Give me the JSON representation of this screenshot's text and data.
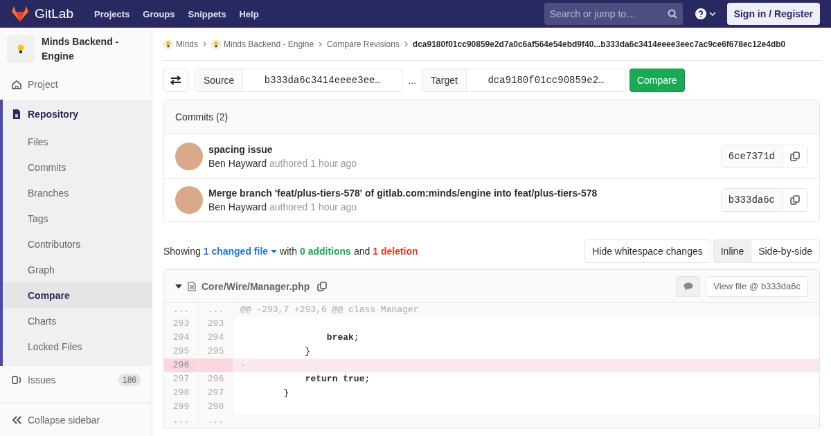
{
  "navbar": {
    "brand": "GitLab",
    "links": [
      "Projects",
      "Groups",
      "Snippets",
      "Help"
    ],
    "search": {
      "placeholder": "Search or jump to…"
    },
    "sign_in": "Sign in / Register"
  },
  "sidebar": {
    "project_name": "Minds Backend - Engine",
    "items": [
      {
        "label": "Project",
        "kind": "project",
        "selected": false
      },
      {
        "label": "Repository",
        "kind": "repository",
        "selected": true,
        "children": [
          {
            "label": "Files",
            "selected": false
          },
          {
            "label": "Commits",
            "selected": false
          },
          {
            "label": "Branches",
            "selected": false
          },
          {
            "label": "Tags",
            "selected": false
          },
          {
            "label": "Contributors",
            "selected": false
          },
          {
            "label": "Graph",
            "selected": false
          },
          {
            "label": "Compare",
            "selected": true
          },
          {
            "label": "Charts",
            "selected": false
          },
          {
            "label": "Locked Files",
            "selected": false
          }
        ]
      },
      {
        "label": "Issues",
        "kind": "issues",
        "selected": false,
        "count": "186"
      }
    ],
    "collapse": "Collapse sidebar"
  },
  "breadcrumbs": [
    {
      "label": "Minds",
      "kind": "group"
    },
    {
      "label": "Minds Backend - Engine",
      "kind": "group"
    },
    {
      "label": "Compare Revisions",
      "kind": "link"
    },
    {
      "label": "dca9180f01cc90859e2d7a0c6af564e54ebd9f40...b333da6c3414eeee3eec7ac9ce6f678ec12e4db0",
      "kind": "current"
    }
  ],
  "compare": {
    "source_label": "Source",
    "source_value": "b333da6c3414eeee3ee…",
    "separator": "...",
    "target_label": "Target",
    "target_value": "dca9180f01cc90859e2…",
    "button": "Compare"
  },
  "commits": {
    "title": "Commits (2)",
    "items": [
      {
        "message": "spacing issue",
        "author": "Ben Hayward",
        "meta": "authored 1 hour ago",
        "sha": "6ce7371d"
      },
      {
        "message": "Merge branch 'feat/plus-tiers-578' of gitlab.com:minds/engine into feat/plus-tiers-578",
        "author": "Ben Hayward",
        "meta": "authored 1 hour ago",
        "sha": "b333da6c"
      }
    ]
  },
  "summary": [
    {
      "text": "Showing",
      "kind": "text"
    },
    {
      "text": "1 changed file",
      "kind": "dropdown"
    },
    {
      "text": "with",
      "kind": "text"
    },
    {
      "text": "0 additions",
      "kind": "added"
    },
    {
      "text": "and",
      "kind": "text"
    },
    {
      "text": "1 deletion",
      "kind": "removed"
    }
  ],
  "whitespace_button": "Hide whitespace changes",
  "view_modes": [
    {
      "label": "Inline",
      "selected": true
    },
    {
      "label": "Side-by-side",
      "selected": false
    }
  ],
  "file": {
    "path": "Core/Wire/Manager.php",
    "view_file": "View file @ b333da6c",
    "lines": [
      {
        "kind": "match",
        "old": "...",
        "new": "...",
        "code": "@@ -293,7 +293,6 @@ class Manager"
      },
      {
        "kind": "context",
        "old": "293",
        "new": "293"
      },
      {
        "kind": "context",
        "old": "294",
        "new": "294",
        "code": "                **break**;"
      },
      {
        "kind": "context",
        "old": "295",
        "new": "295",
        "code": "            }"
      },
      {
        "kind": "removed",
        "old": "296",
        "code": "-"
      },
      {
        "kind": "context",
        "old": "297",
        "new": "296",
        "code": "            **return** **true**;"
      },
      {
        "kind": "context",
        "old": "298",
        "new": "297",
        "code": "        }"
      },
      {
        "kind": "context",
        "old": "299",
        "new": "298"
      },
      {
        "kind": "match",
        "old": "...",
        "new": "..."
      }
    ]
  }
}
